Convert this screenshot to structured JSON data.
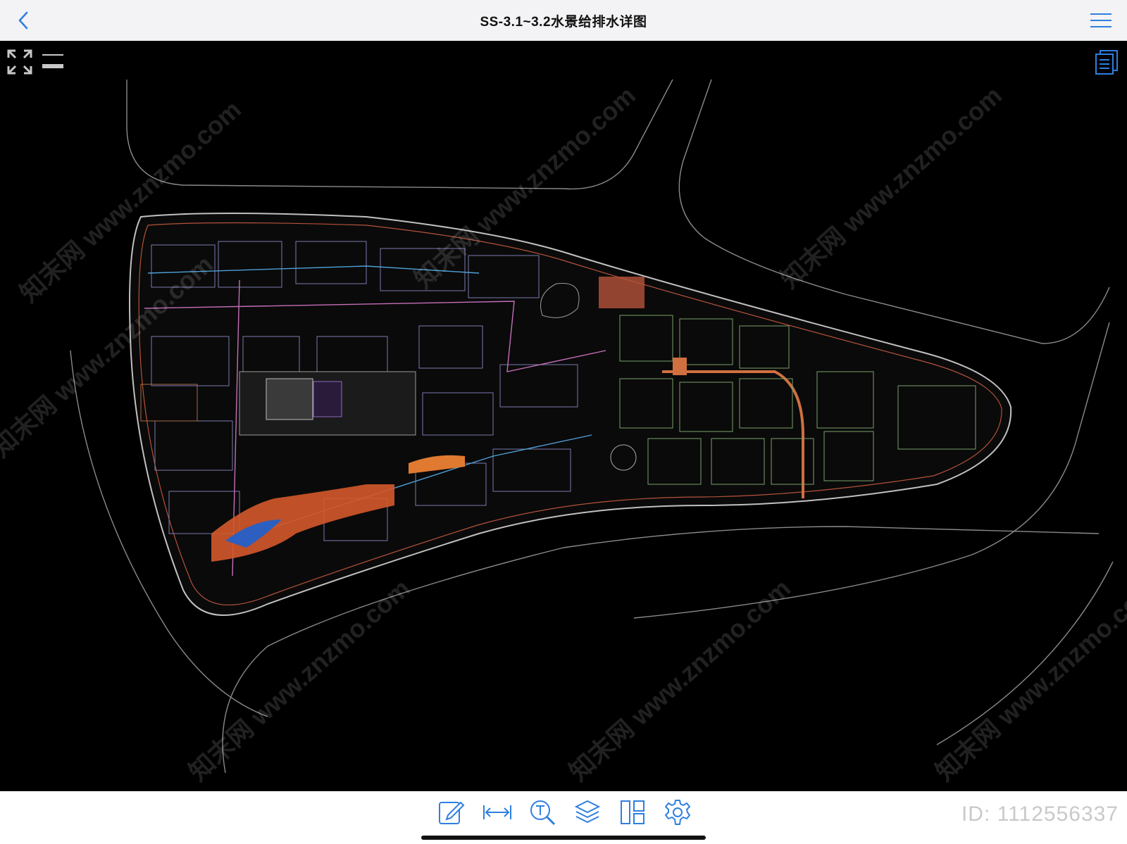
{
  "navbar": {
    "title": "SS-3.1~3.2水景给排水详图",
    "back_icon": "chevron-left-icon",
    "menu_icon": "hamburger-menu-icon",
    "accent_color": "#2f7fe0"
  },
  "viewer": {
    "background_color": "#000000",
    "fit_icon": "expand-arrows-icon",
    "lines_icon": "line-weight-icon",
    "pages_icon": "document-pages-icon",
    "watermark_text": "知末网 www.znzmo.com",
    "brand_logo": "知末"
  },
  "toolbar": {
    "tools": [
      {
        "name": "annotate",
        "icon": "pencil-edit-icon"
      },
      {
        "name": "measure",
        "icon": "measure-arrows-icon"
      },
      {
        "name": "text-search",
        "icon": "text-search-icon"
      },
      {
        "name": "layers",
        "icon": "layers-icon"
      },
      {
        "name": "layout",
        "icon": "layout-panels-icon"
      },
      {
        "name": "settings",
        "icon": "gear-icon"
      }
    ],
    "id_label": "ID: 1112556337"
  }
}
